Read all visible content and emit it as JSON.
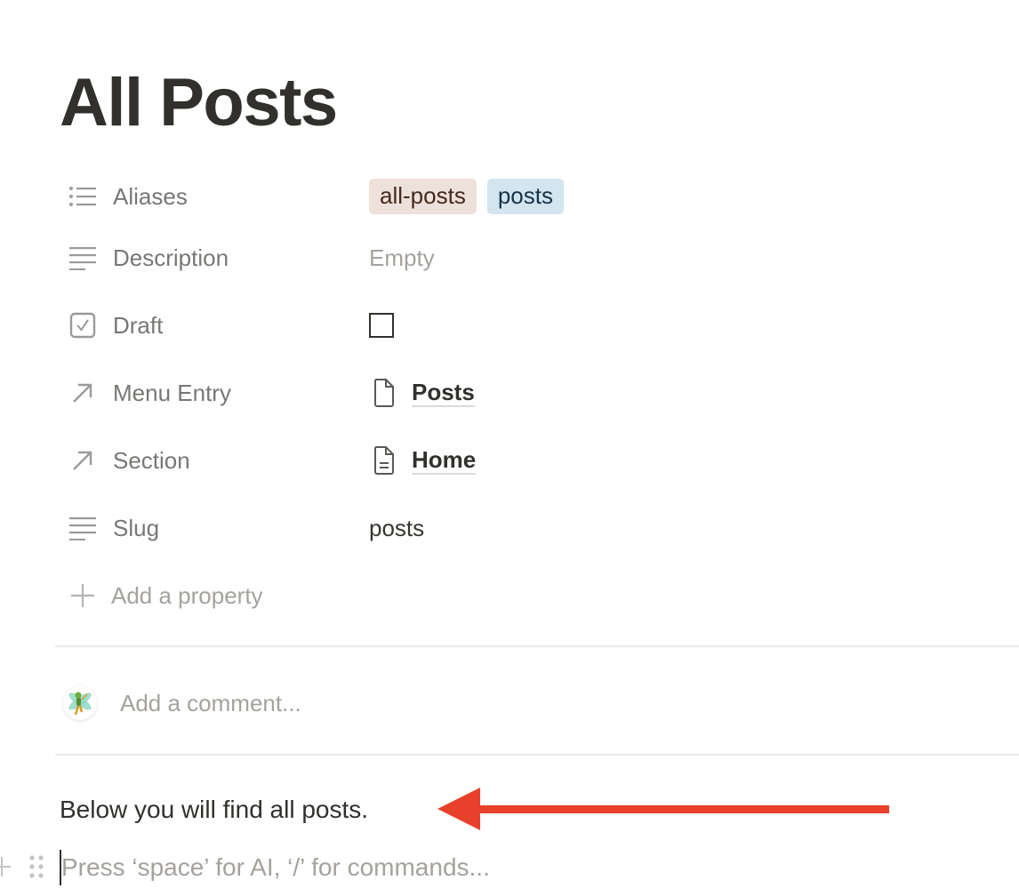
{
  "page": {
    "title": "All Posts"
  },
  "properties": [
    {
      "name": "Aliases",
      "icon": "multi-select-icon",
      "type": "multi_select",
      "tags": [
        "all-posts",
        "posts"
      ],
      "tag_colors": [
        "#eee0da",
        "#d3e5ef"
      ]
    },
    {
      "name": "Description",
      "icon": "text-icon",
      "type": "text",
      "value": "Empty"
    },
    {
      "name": "Draft",
      "icon": "checkbox-icon",
      "type": "checkbox",
      "checked": false
    },
    {
      "name": "Menu Entry",
      "icon": "relation-arrow-icon",
      "type": "relation",
      "value": "Posts",
      "page_icon": "blank-page-icon"
    },
    {
      "name": "Section",
      "icon": "relation-arrow-icon",
      "type": "relation",
      "value": "Home",
      "page_icon": "text-page-icon"
    },
    {
      "name": "Slug",
      "icon": "text-icon",
      "type": "text",
      "value": "posts"
    }
  ],
  "add_property": {
    "label": "Add a property",
    "icon": "plus-icon"
  },
  "comment": {
    "placeholder": "Add a comment...",
    "avatar": "fairy-avatar"
  },
  "body": {
    "paragraph": "Below you will find all posts.",
    "editor_placeholder": "Press ‘space’ for AI, ‘/’ for commands..."
  },
  "annotation": {
    "type": "arrow",
    "direction": "left",
    "color": "#e8412b"
  }
}
